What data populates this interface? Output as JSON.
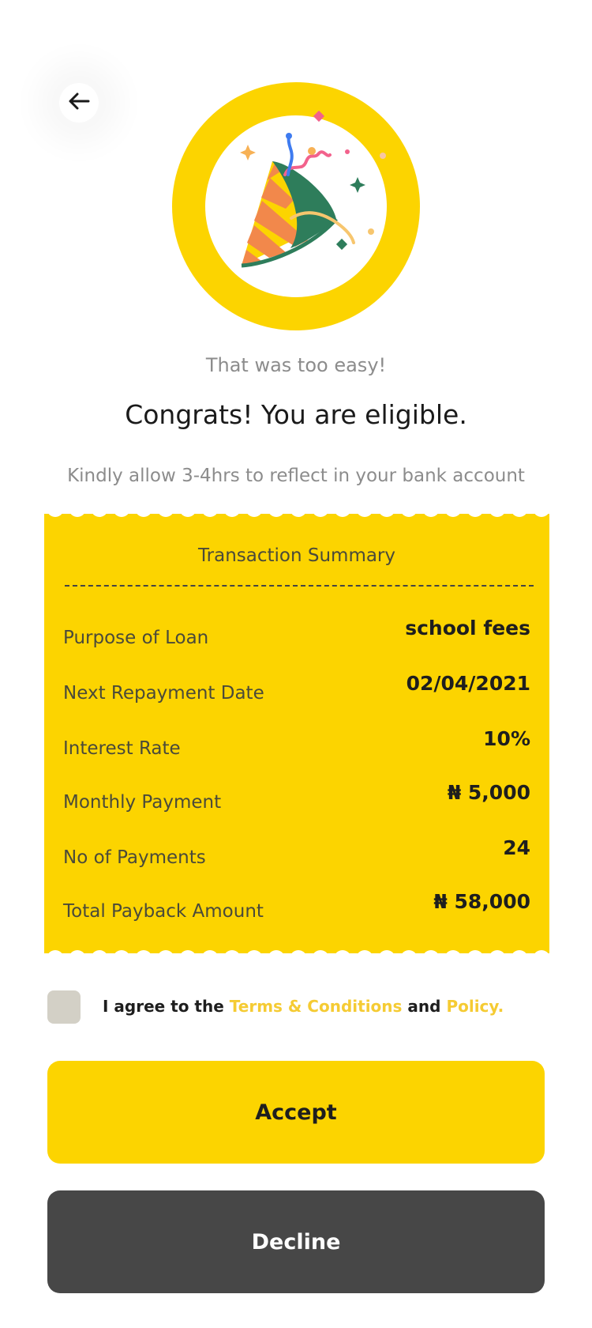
{
  "nav": {
    "back_icon": "arrow-left-icon"
  },
  "hero": {
    "icon": "party-popper-icon",
    "ring_color": "#FCD400"
  },
  "header": {
    "subtitle": "That was too easy!",
    "title": "Congrats! You are eligible.",
    "notice": "Kindly allow 3-4hrs to reflect in your bank account"
  },
  "summary": {
    "title": "Transaction Summary",
    "rows": [
      {
        "label": "Purpose of Loan",
        "value": "school fees"
      },
      {
        "label": "Next Repayment Date",
        "value": "02/04/2021"
      },
      {
        "label": "Interest Rate",
        "value": "10%"
      },
      {
        "label": "Monthly Payment",
        "value": "₦ 5,000"
      },
      {
        "label": "No of Payments",
        "value": "24"
      },
      {
        "label": "Total Payback Amount",
        "value": "₦ 58,000"
      }
    ]
  },
  "agreement": {
    "prefix": "I agree to the",
    "terms_link": "Terms & Conditions",
    "joiner": "and",
    "policy_link": "Policy.",
    "checked": false
  },
  "actions": {
    "accept_label": "Accept",
    "decline_label": "Decline"
  },
  "colors": {
    "accent": "#FCD400",
    "link": "#F5CB33",
    "decline_bg": "#474747",
    "checkbox_bg": "#D3D0C6"
  }
}
